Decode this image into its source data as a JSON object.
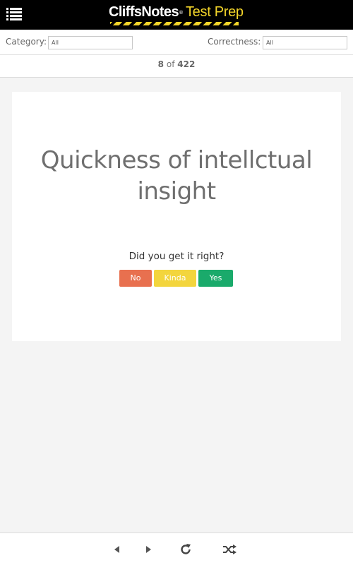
{
  "header": {
    "brand_main": "CliffsNotes",
    "brand_reg": "®",
    "brand_sub": "Test Prep",
    "menu_icon": "hamburger-list-icon",
    "brand_color": "#f3d52a"
  },
  "filters": {
    "category_label": "Category:",
    "category_value": "All",
    "correctness_label": "Correctness:",
    "correctness_value": "All"
  },
  "counter": {
    "current": "8",
    "of": "of",
    "total": "422"
  },
  "card": {
    "text": "Quickness of intellctual insight"
  },
  "answer": {
    "prompt": "Did you get it right?",
    "no_label": "No",
    "kinda_label": "Kinda",
    "yes_label": "Yes",
    "colors": {
      "no": "#e8704f",
      "kinda": "#f3d53d",
      "yes": "#1aaa6b"
    }
  },
  "bottom_nav": {
    "icons": [
      "previous-icon",
      "next-icon",
      "reload-icon",
      "shuffle-icon"
    ]
  }
}
